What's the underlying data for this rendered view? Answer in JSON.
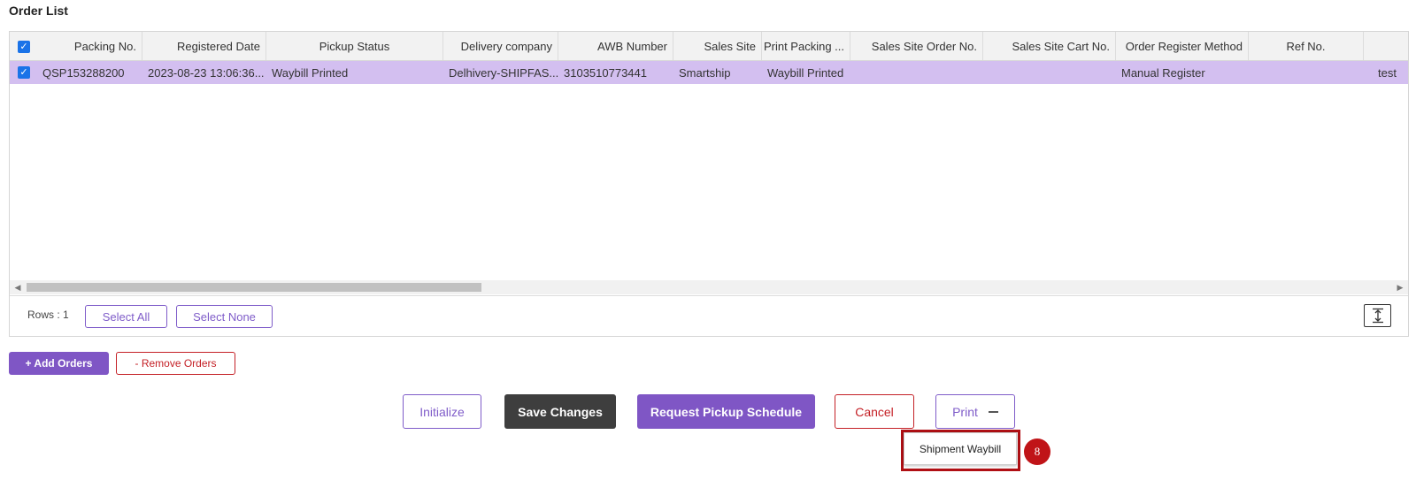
{
  "page": {
    "title": "Order List"
  },
  "table": {
    "columns": [
      "Packing No.",
      "Registered Date",
      "Pickup Status",
      "Delivery company",
      "AWB Number",
      "Sales Site",
      "Print Packing ...",
      "Sales Site Order No.",
      "Sales Site Cart No.",
      "Order Register Method",
      "Ref No."
    ],
    "rows": [
      {
        "checked": true,
        "packing_no": "QSP153288200",
        "registered_date": "2023-08-23 13:06:36...",
        "pickup_status": "Waybill Printed",
        "delivery_company": "Delhivery-SHIPFAS...",
        "awb_number": "3103510773441",
        "sales_site": "Smartship",
        "print_packing": "Waybill Printed",
        "sales_site_order_no": "",
        "sales_site_cart_no": "",
        "order_register_method": "Manual Register",
        "ref_no": "",
        "extra": "test"
      }
    ],
    "header_checked": true
  },
  "footer": {
    "rows_label": "Rows : 1",
    "select_all": "Select All",
    "select_none": "Select None",
    "expand_icon": "expand-vertical-icon"
  },
  "actions": {
    "add_orders": "+ Add Orders",
    "remove_orders": "- Remove Orders",
    "initialize": "Initialize",
    "save_changes": "Save Changes",
    "request_pickup": "Request Pickup Schedule",
    "cancel": "Cancel",
    "print": "Print"
  },
  "print_menu": {
    "items": [
      "Shipment Waybill"
    ]
  },
  "annotation": {
    "step": "8"
  },
  "colors": {
    "accent": "#7f56c5",
    "selected_row": "#d3bff0",
    "danger": "#c42026",
    "dark_button": "#3e3e3e",
    "annotation": "#c01418"
  }
}
